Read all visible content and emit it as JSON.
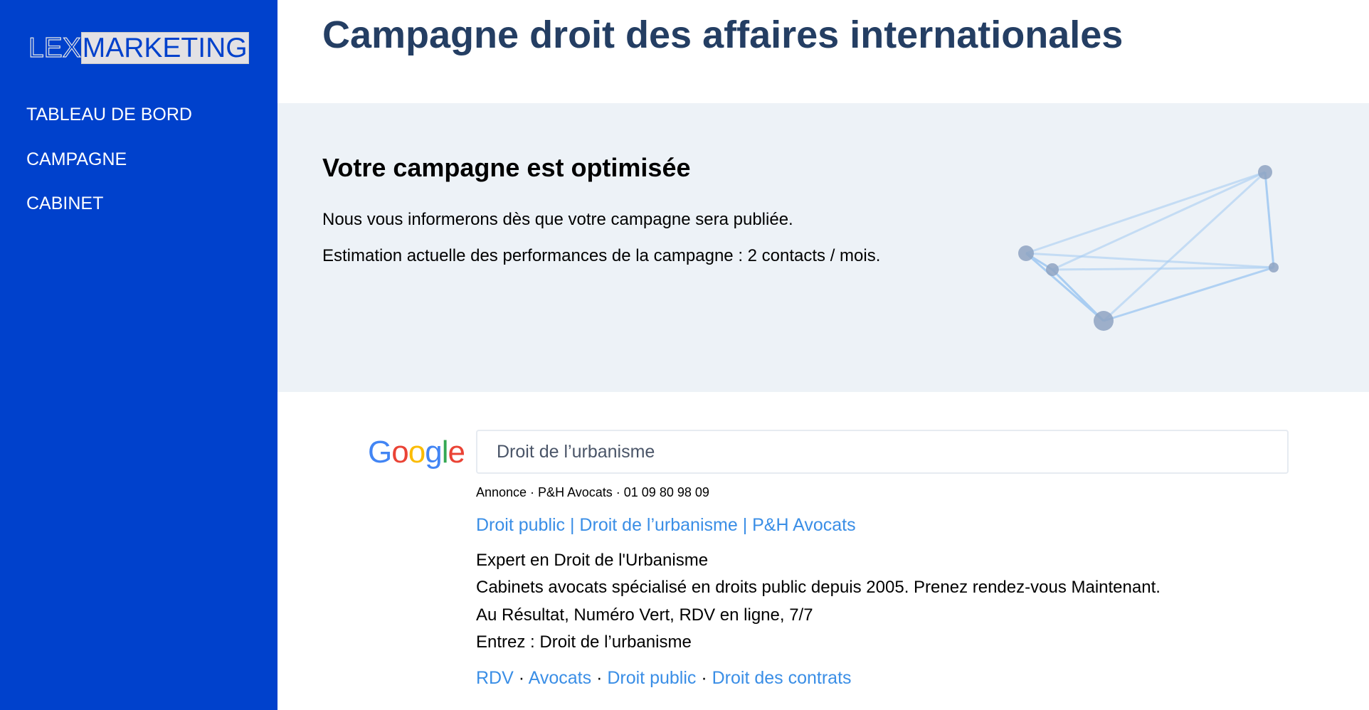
{
  "sidebar": {
    "logo": {
      "part1": "LEX",
      "part2": "MARKETING"
    },
    "items": [
      {
        "label": "TABLEAU DE BORD"
      },
      {
        "label": "CAMPAGNE"
      },
      {
        "label": "CABINET"
      }
    ]
  },
  "header": {
    "title": "Campagne droit des affaires internationales"
  },
  "status": {
    "heading": "Votre campagne est optimisée",
    "line1": "Nous vous informerons dès que votre campagne sera publiée.",
    "line2": "Estimation actuelle des performances de la campagne : 2 contacts / mois.",
    "illustration_colors": {
      "node": "#8ea3c2",
      "edge": "#a9cdf2"
    }
  },
  "preview": {
    "logo": {
      "G": "G",
      "o1": "o",
      "o2": "o",
      "g": "g",
      "l": "l",
      "e": "e"
    },
    "search_query": "Droit de l’urbanisme",
    "ad_meta": "Annonce · P&H Avocats · 01 09 80 98 09",
    "ad_title": "Droit public | Droit de l’urbanisme | P&H Avocats",
    "ad_lines": [
      "Expert en Droit de l'Urbanisme",
      "Cabinets avocats spécialisé en droits public depuis 2005. Prenez rendez-vous Maintenant.",
      "Au Résultat, Numéro Vert, RDV en ligne, 7/7",
      "Entrez : Droit de l’urbanisme"
    ],
    "sitelinks": [
      "RDV",
      "Avocats",
      "Droit public",
      "Droit des contrats"
    ],
    "separator": " · ",
    "link_color": "#3a8ee6"
  }
}
